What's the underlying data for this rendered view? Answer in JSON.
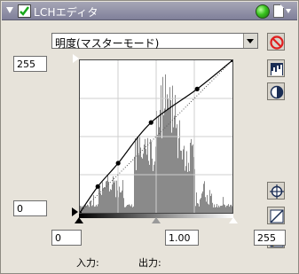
{
  "title": "LCHエディタ",
  "mode_dropdown": {
    "value": "明度(マスターモード)"
  },
  "output_max_field": {
    "value": "255"
  },
  "output_min_field": {
    "value": "0"
  },
  "input_black_field": {
    "value": "0"
  },
  "gamma_field": {
    "value": "1.00"
  },
  "input_white_field": {
    "value": "255"
  },
  "labels": {
    "input": "入力:",
    "output": "出力:"
  },
  "colors": {
    "titlebar": "#8e8ea4",
    "panel": "#e7e3da",
    "histogram": "#808080",
    "curve": "#000000",
    "reset_icon": "#e01e1e"
  },
  "icons": [
    "reset-icon",
    "histogram-icon",
    "contrast-icon",
    "eyedropper-target-icon",
    "curve-straight-icon",
    "curve-pencil-icon"
  ],
  "curve_points": [
    [
      0,
      0
    ],
    [
      30,
      44
    ],
    [
      64,
      83
    ],
    [
      119,
      151
    ],
    [
      196,
      207
    ],
    [
      255,
      255
    ]
  ]
}
